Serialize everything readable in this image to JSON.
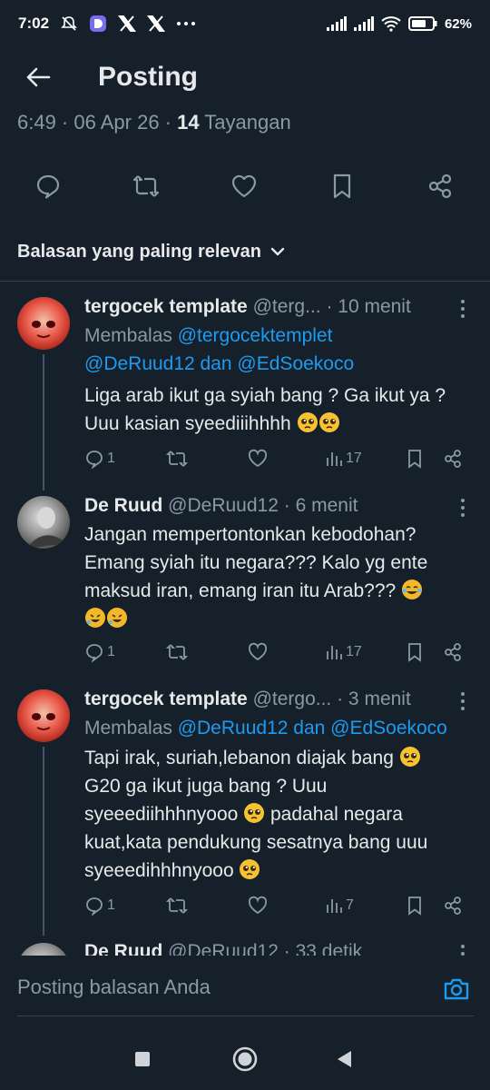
{
  "status_bar": {
    "time": "7:02",
    "battery": "62"
  },
  "header": {
    "title": "Posting"
  },
  "post_meta": {
    "time_date": "6:49 · 06 Apr 26 · ",
    "views_count": "14",
    "views_label": " Tayangan"
  },
  "sort": {
    "label": "Balasan yang paling relevan"
  },
  "replies": [
    {
      "name": "tergocek template",
      "handle": "@terg...",
      "time": "· 10 menit",
      "replying_prefix": "Membalas ",
      "replying_mention1": "@tergocektemplet",
      "replying_mention2": "@DeRuud12 dan @EdSoekoco",
      "text_lines": [
        "Liga arab ikut ga syiah bang ? Ga ikut ya ?",
        "Uuu kasian syeediiihhhh"
      ],
      "reply_count": "1",
      "views": "17"
    },
    {
      "name": "De Ruud",
      "handle": "@DeRuud12",
      "time": "· 6 menit",
      "text_lines": [
        "Jangan mempertontonkan kebodohan?",
        "Emang syiah itu negara??? Kalo yg ente",
        "maksud iran, emang iran itu Arab???"
      ],
      "reply_count": "1",
      "views": "17"
    },
    {
      "name": "tergocek template",
      "handle": "@tergo...",
      "time": "· 3 menit",
      "replying_prefix": "Membalas ",
      "replying_mention": "@DeRuud12 dan @EdSoekoco",
      "text_lines": [
        "Tapi irak, suriah,lebanon diajak bang",
        "G20 ga ikut juga bang ? Uuu",
        "syeeediihhhnyooo",
        " padahal negara",
        "kuat,kata pendukung sesatnya bang uuu",
        "syeeedihhhnyooo"
      ],
      "reply_count": "1",
      "views": "7"
    },
    {
      "name": "De Ruud",
      "handle": "@DeRuud12",
      "time": "· 33 detik"
    }
  ],
  "composer": {
    "placeholder": "Posting balasan Anda"
  },
  "colors": {
    "background": "#15202b",
    "accent": "#1d9bf0",
    "muted": "#8b98a5",
    "text": "#e7e9ea"
  }
}
